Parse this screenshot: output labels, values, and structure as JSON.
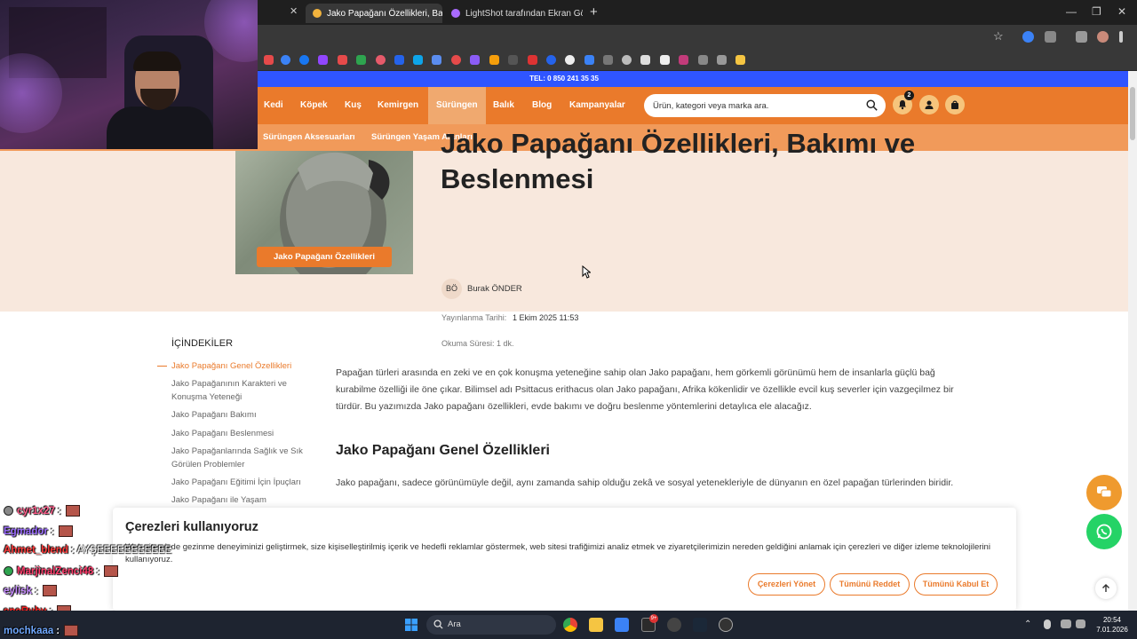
{
  "browser": {
    "tabs": [
      {
        "label": "Jako Papağanı Özellikleri, Bakım",
        "active": true
      },
      {
        "label": "LightShot tarafından Ekran Görü",
        "active": false
      }
    ],
    "new_tab": "+",
    "close_glyph": "✕",
    "window_controls": {
      "minimize": "—",
      "restore": "❐",
      "close": "✕"
    },
    "bookmark_star": "☆"
  },
  "site": {
    "phone": "TEL: 0 850 241 35 35",
    "nav": [
      "Kedi",
      "Köpek",
      "Kuş",
      "Kemirgen",
      "Sürüngen",
      "Balık",
      "Blog",
      "Kampanyalar"
    ],
    "nav_active": "Sürüngen",
    "search_placeholder": "Ürün, kategori veya marka ara.",
    "notification_count": "2",
    "subnav": [
      "Sürüngen Aksesuarları",
      "Sürüngen Yaşam Alanları"
    ],
    "accent": "#ea7a2b"
  },
  "article": {
    "title_line1": "Jako Papağanı Özellikleri, Bakımı ve",
    "title_line2": "Beslenmesi",
    "image_badge": "Jako Papağanı Özellikleri",
    "author_initials": "BÖ",
    "author_name": "Burak ÖNDER",
    "published_label": "Yayınlanma Tarihi:",
    "published_value": "1 Ekim 2025 11:53",
    "read_time": "Okuma Süresi: 1 dk.",
    "intro": "Papağan türleri arasında en zeki ve en çok konuşma yeteneğine sahip olan Jako papağanı, hem görkemli görünümü hem de insanlarla güçlü bağ kurabilme özelliği ile öne çıkar. Bilimsel adı Psittacus erithacus olan Jako papağanı, Afrika kökenlidir ve özellikle evcil kuş severler için vazgeçilmez bir türdür. Bu yazımızda Jako papağanı özellikleri, evde bakımı ve doğru beslenme yöntemlerini detaylıca ele alacağız.",
    "section_heading": "Jako Papağanı Genel Özellikleri",
    "section_para": "Jako papağanı, sadece görünümüyle değil, aynı zamanda sahip olduğu zekâ ve sosyal yetenekleriyle de dünyanın en özel papağan türlerinden biridir."
  },
  "toc": {
    "title": "İÇİNDEKİLER",
    "items": [
      "Jako Papağanı Genel Özellikleri",
      "Jako Papağanının Karakteri ve Konuşma Yeteneği",
      "Jako Papağanı Bakımı",
      "Jako Papağanı Beslenmesi",
      "Jako Papağanlarında Sağlık ve Sık Görülen Problemler",
      "Jako Papağanı Eğitimi İçin İpuçları",
      "Jako Papağanı ile Yaşam"
    ]
  },
  "cookie": {
    "title": "Çerezleri kullanıyoruz",
    "text": "Web sitemizde gezinme deneyiminizi geliştirmek, size kişiselleştirilmiş içerik ve hedefli reklamlar göstermek, web sitesi trafiğimizi analiz etmek ve ziyaretçilerimizin nereden geldiğini anlamak için çerezleri ve diğer izleme teknolojilerini kullanıyoruz.",
    "manage": "Çerezleri Yönet",
    "reject": "Tümünü Reddet",
    "accept": "Tümünü Kabul Et"
  },
  "stream_chat": [
    {
      "user": "cyr1x27",
      "color": "#ff5c8a",
      "msg": ""
    },
    {
      "user": "Egmador",
      "color": "#9b6bff",
      "msg": ""
    },
    {
      "user": "Ahmet_blend",
      "color": "#ff3b3b",
      "msg": "AYŞEEEEEEEEEEE"
    },
    {
      "user": "MarjinalZenci48",
      "color": "#ff3b6b",
      "msg": ""
    },
    {
      "user": "eylisk",
      "color": "#c78cff",
      "msg": ""
    },
    {
      "user": "eneRuby",
      "color": "#ff2020",
      "msg": ""
    },
    {
      "user": "mochkaaa",
      "color": "#6fa8ff",
      "msg": ""
    }
  ],
  "taskbar": {
    "search": "Ara",
    "time": "20:54",
    "date": "7.01.2026",
    "badge": "9+"
  }
}
